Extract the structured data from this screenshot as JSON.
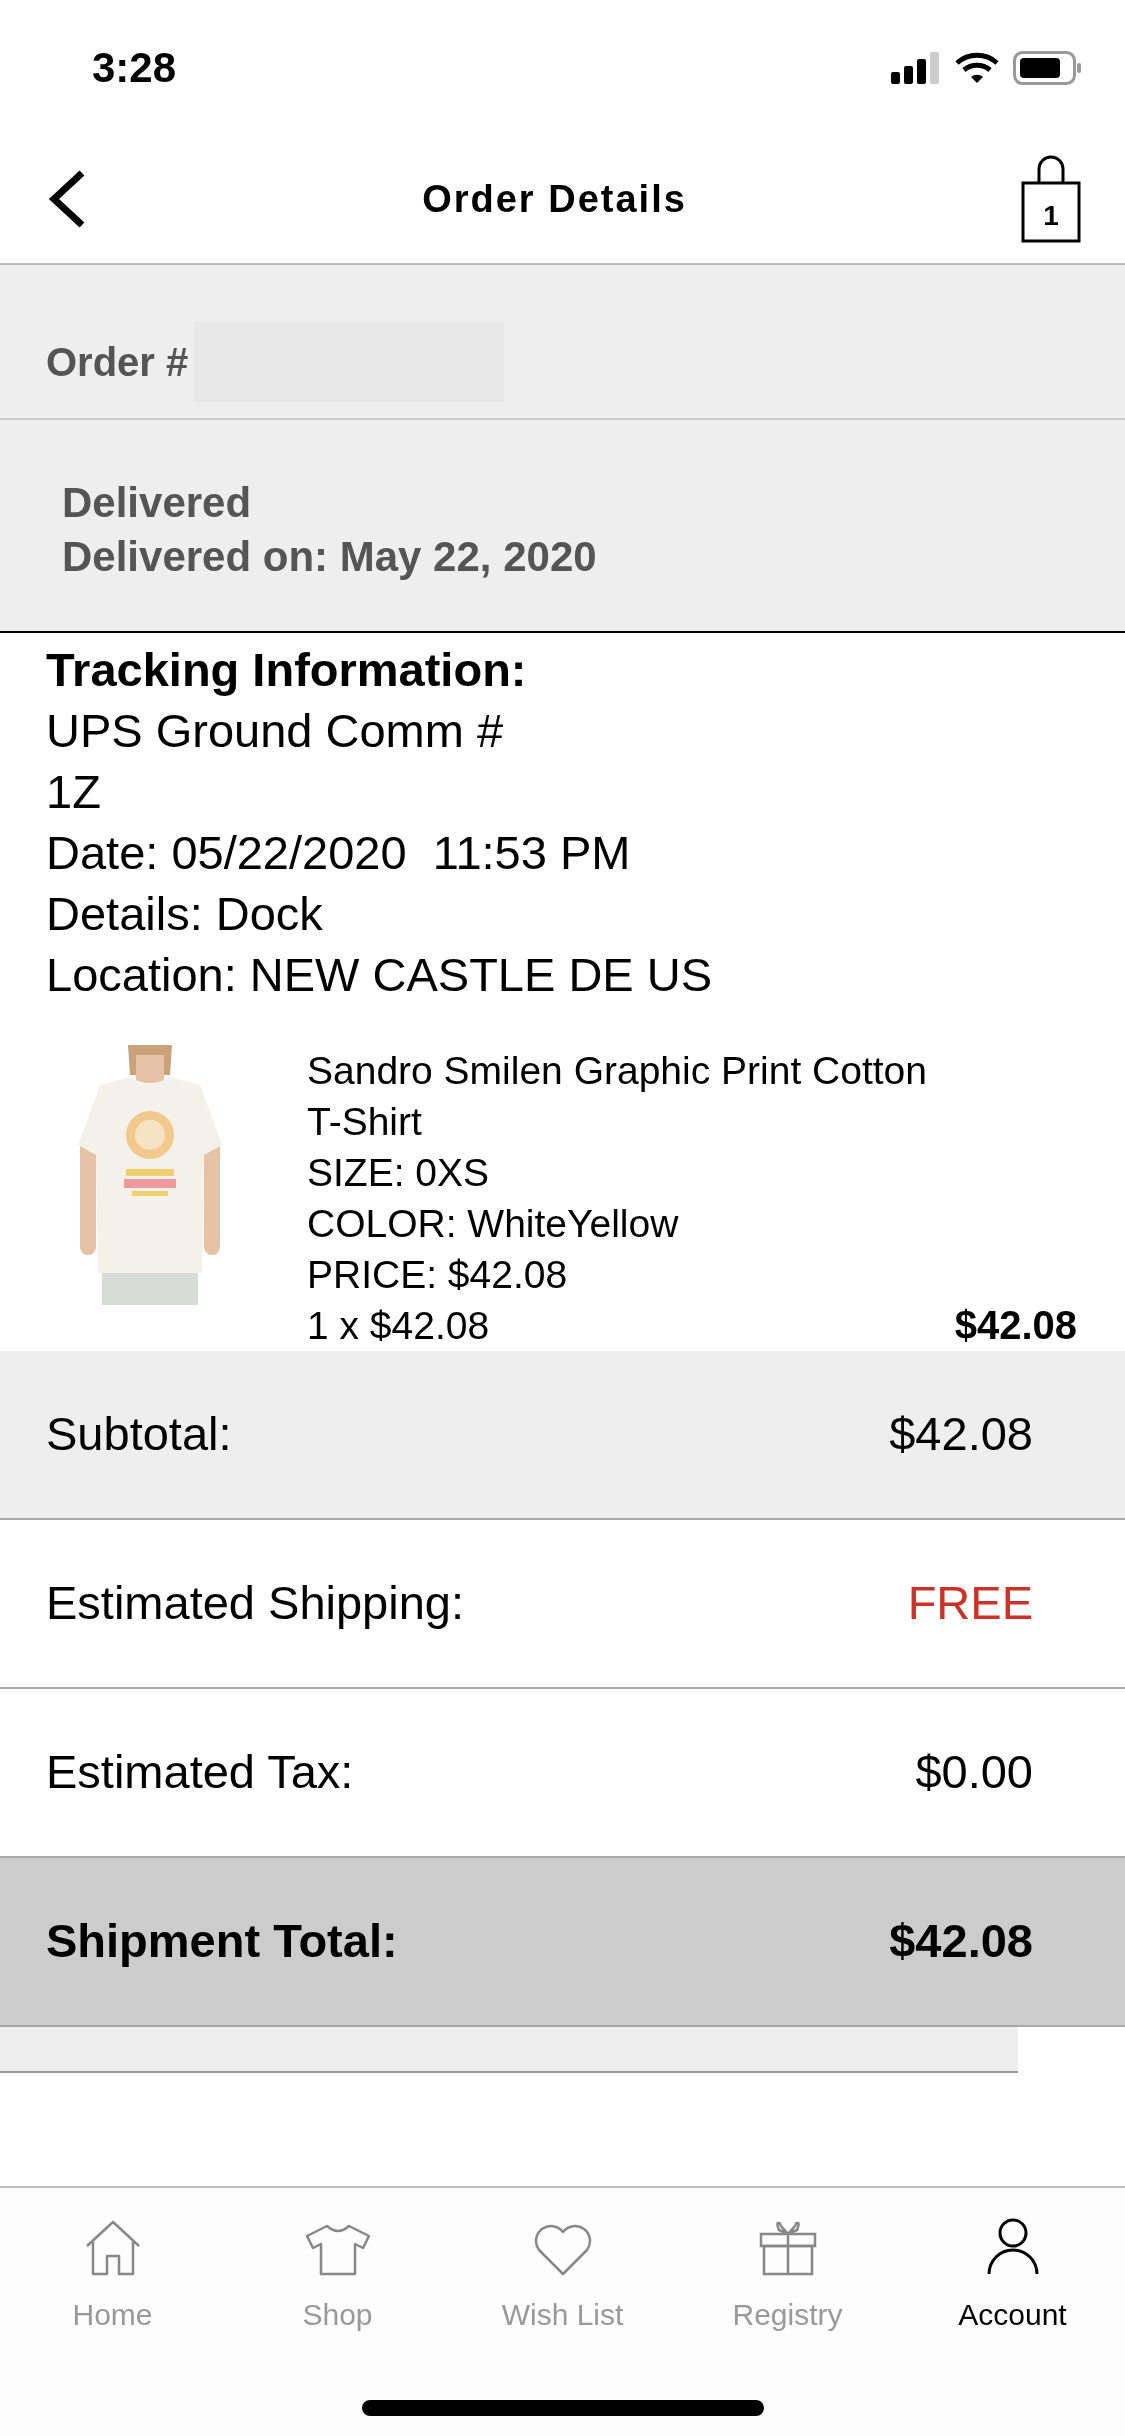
{
  "status_bar": {
    "time": "3:28"
  },
  "nav": {
    "title": "Order Details",
    "bag_count": "1"
  },
  "order": {
    "label": "Order #"
  },
  "delivery": {
    "status": "Delivered",
    "date_line": "Delivered on: May 22, 2020"
  },
  "tracking": {
    "heading": "Tracking Information:",
    "lines": [
      "UPS Ground Comm #",
      "1Z",
      "Date: 05/22/2020  11:53 PM",
      "Details: Dock",
      "Location: NEW CASTLE DE US"
    ]
  },
  "item": {
    "image": {
      "kind": "picture"
    },
    "name": "Sandro Smilen Graphic Print Cotton T-Shirt",
    "details": [
      "SIZE: 0XS",
      "COLOR: WhiteYellow",
      "PRICE: $42.08"
    ],
    "quantity_line": "1 x $42.08",
    "line_total": "$42.08"
  },
  "summary": [
    {
      "kind": "plain",
      "label": "Subtotal:",
      "value": "$42.08"
    },
    {
      "kind": "highlight",
      "label": "Estimated Shipping:",
      "value": "FREE"
    },
    {
      "kind": "plain",
      "label": "Estimated Tax:",
      "value": "$0.00"
    },
    {
      "kind": "total",
      "label": "Shipment Total:",
      "value": "$42.08"
    }
  ],
  "tab_bar": [
    {
      "label": "Home",
      "selected": false
    },
    {
      "label": "Shop",
      "selected": false
    },
    {
      "label": "Wish List",
      "selected": false
    },
    {
      "label": "Registry",
      "selected": false
    },
    {
      "label": "Account",
      "selected": true
    }
  ]
}
